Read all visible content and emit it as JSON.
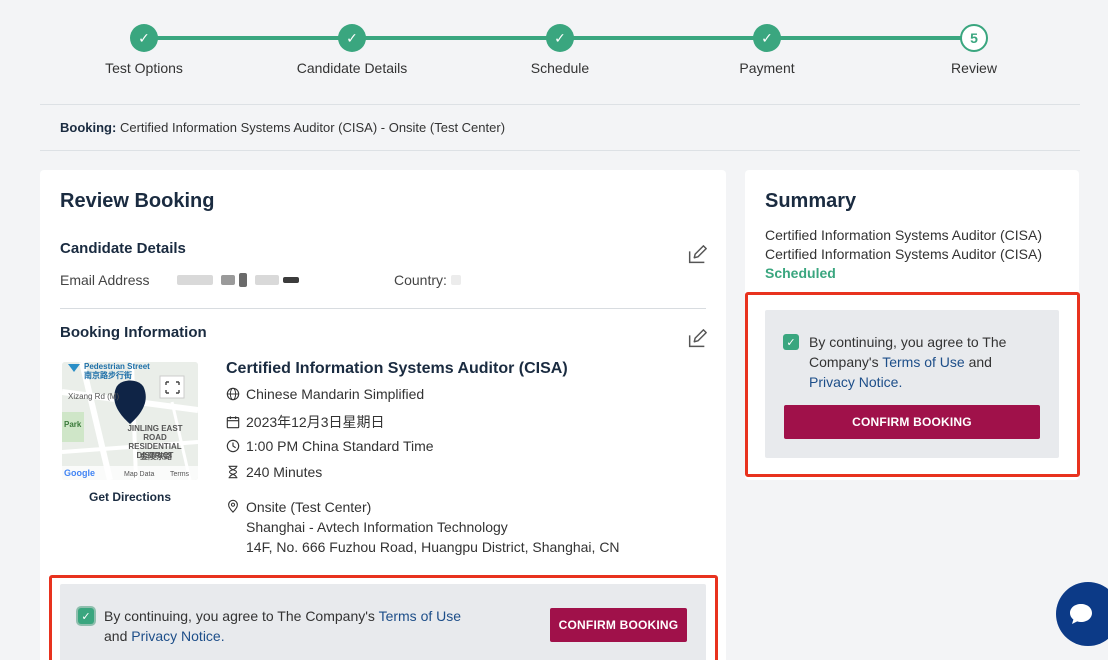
{
  "stepper": {
    "steps": [
      {
        "label": "Test Options",
        "state": "done",
        "mark": "✓"
      },
      {
        "label": "Candidate Details",
        "state": "done",
        "mark": "✓"
      },
      {
        "label": "Schedule",
        "state": "done",
        "mark": "✓"
      },
      {
        "label": "Payment",
        "state": "done",
        "mark": "✓"
      },
      {
        "label": "Review",
        "state": "current",
        "mark": "5"
      }
    ]
  },
  "booking_bar": {
    "prefix": "Booking:",
    "text": "Certified Information Systems Auditor (CISA) - Onsite (Test Center)"
  },
  "review": {
    "title": "Review Booking",
    "candidate": {
      "heading": "Candidate Details",
      "email_label": "Email Address",
      "country_label": "Country:"
    },
    "booking_info": {
      "heading": "Booking Information",
      "exam_title": "Certified Information Systems Auditor (CISA)",
      "language": "Chinese Mandarin Simplified",
      "date": "2023年12月3日星期日",
      "time": "1:00 PM China Standard Time",
      "duration": "240 Minutes",
      "location_type": "Onsite (Test Center)",
      "center_name": "Shanghai - Avtech Information Technology",
      "address": "14F, No. 666 Fuzhou Road, Huangpu District, Shanghai, CN",
      "get_directions": "Get Directions"
    },
    "map": {
      "label_top": "Pedestrian Street",
      "label_top_cn": "南京路步行街",
      "label_road": "Xizang Rd (M)",
      "label_park": "Park",
      "label_district": "JINLING EAST ROAD RESIDENTIAL DISTRICT",
      "label_district_cn": "金陵东路",
      "footer_data": "Map Data",
      "footer_terms": "Terms",
      "logo": "Google"
    },
    "consent": {
      "text_before": "By continuing, you agree to The Company's",
      "terms_link": "Terms of Use",
      "and": "and",
      "privacy_link": "Privacy Notice.",
      "button": "CONFIRM BOOKING"
    }
  },
  "summary": {
    "title": "Summary",
    "line1": "Certified Information Systems Auditor (CISA)",
    "line2": "Certified Information Systems Auditor (CISA)",
    "status": "Scheduled",
    "consent": {
      "text_before": "By continuing, you agree to The Company's",
      "terms_link": "Terms of Use",
      "and": "and",
      "privacy_link": "Privacy Notice.",
      "button": "CONFIRM BOOKING"
    }
  },
  "colors": {
    "accent_green": "#3aa67f",
    "confirm_button": "#a0114a",
    "heading_navy": "#1a2b40",
    "highlight_red": "#e8321e",
    "chat_blue": "#0c3a87"
  }
}
